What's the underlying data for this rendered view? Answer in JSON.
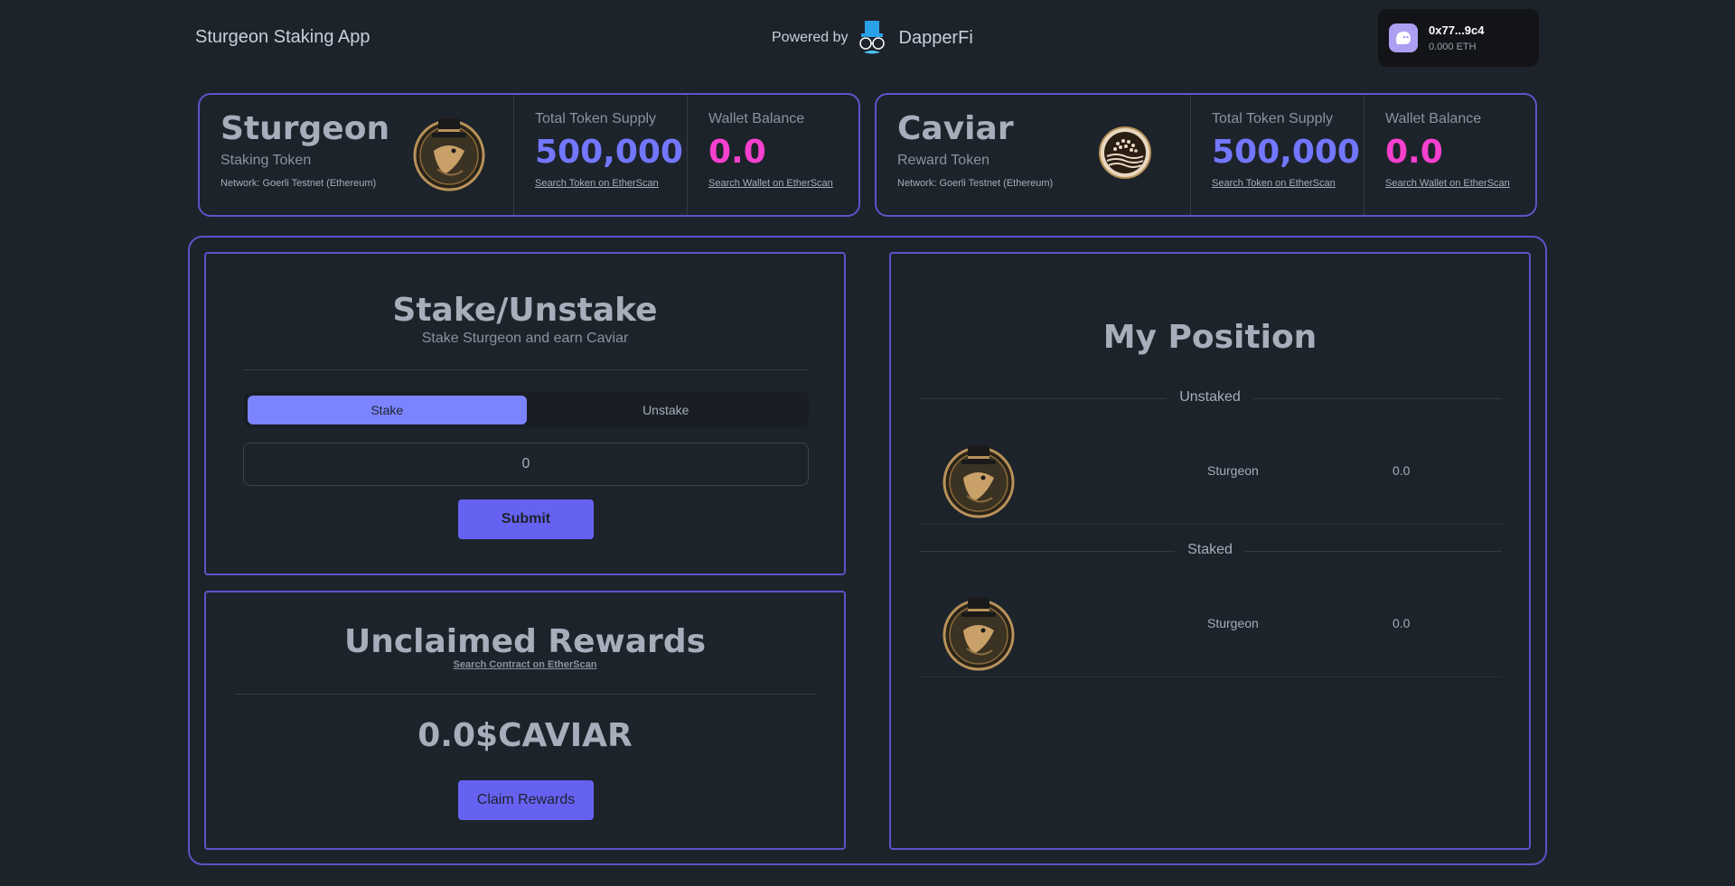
{
  "header": {
    "app_title": "Sturgeon Staking App",
    "powered_by": "Powered by",
    "brand": "DapperFi",
    "wallet": {
      "address": "0x77...9c4",
      "balance": "0.000 ETH"
    }
  },
  "tokens": [
    {
      "name": "Sturgeon",
      "role": "Staking Token",
      "network": "Network: Goerli Testnet (Ethereum)",
      "supply_label": "Total Token Supply",
      "supply": "500,000",
      "supply_link": "Search Token on EtherScan",
      "wallet_label": "Wallet Balance",
      "wallet_balance": "0.0",
      "wallet_link": "Search Wallet on EtherScan",
      "logo_icon": "sturgeon-logo-icon"
    },
    {
      "name": "Caviar",
      "role": "Reward Token",
      "network": "Network: Goerli Testnet (Ethereum)",
      "supply_label": "Total Token Supply",
      "supply": "500,000",
      "supply_link": "Search Token on EtherScan",
      "wallet_label": "Wallet Balance",
      "wallet_balance": "0.0",
      "wallet_link": "Search Wallet on EtherScan",
      "logo_icon": "caviar-logo-icon"
    }
  ],
  "stake": {
    "title": "Stake/Unstake",
    "subtitle": "Stake Sturgeon and earn Caviar",
    "tabs": [
      "Stake",
      "Unstake"
    ],
    "active_tab": "Stake",
    "amount_value": "0",
    "submit_label": "Submit"
  },
  "rewards": {
    "title": "Unclaimed Rewards",
    "link": "Search Contract on EtherScan",
    "amount": "0.0$CAVIAR",
    "claim_label": "Claim Rewards"
  },
  "position": {
    "title": "My Position",
    "unstaked_label": "Unstaked",
    "staked_label": "Staked",
    "unstaked": {
      "token": "Sturgeon",
      "amount": "0.0"
    },
    "staked": {
      "token": "Sturgeon",
      "amount": "0.0"
    }
  },
  "colors": {
    "accent": "#6562f2",
    "border": "#5a55c9",
    "supply": "#7377ff",
    "balance": "#f640ce",
    "background": "#1d232a"
  }
}
